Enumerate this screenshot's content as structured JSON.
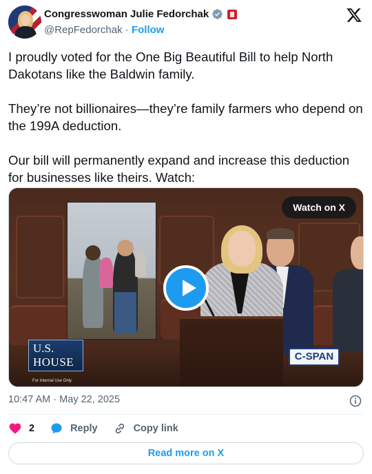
{
  "author": {
    "name": "Congresswoman Julie Fedorchak",
    "handle": "@RepFedorchak",
    "separator": "·",
    "follow_label": "Follow",
    "verified_icon": "verified-badge-icon",
    "affiliation_icon": "government-badge-icon"
  },
  "platform_icon": "x-logo-icon",
  "tweet": {
    "paragraphs": [
      "I proudly voted for the One Big Beautiful Bill to help North Dakotans like the Baldwin family.",
      "They’re not billionaires—they’re family farmers who depend on the 199A deduction.",
      "Our bill will permanently expand and increase this deduction for businesses like theirs. Watch:"
    ]
  },
  "media": {
    "watch_label": "Watch on X",
    "play_icon": "play-icon",
    "logo_line1": "U.S.",
    "logo_line2": "HOUSE",
    "internal_note": "For Internal Use Only",
    "network_label": "C-SPAN"
  },
  "meta": {
    "time": "10:47 AM",
    "separator": "·",
    "date": "May 22, 2025",
    "info_icon": "info-icon"
  },
  "actions": {
    "like_count": "2",
    "reply_label": "Reply",
    "copy_link_label": "Copy link"
  },
  "read_more_label": "Read more on X",
  "colors": {
    "accent": "#1d9bf0",
    "like": "#f91880",
    "text_primary": "#0f1419",
    "text_secondary": "#536471"
  }
}
